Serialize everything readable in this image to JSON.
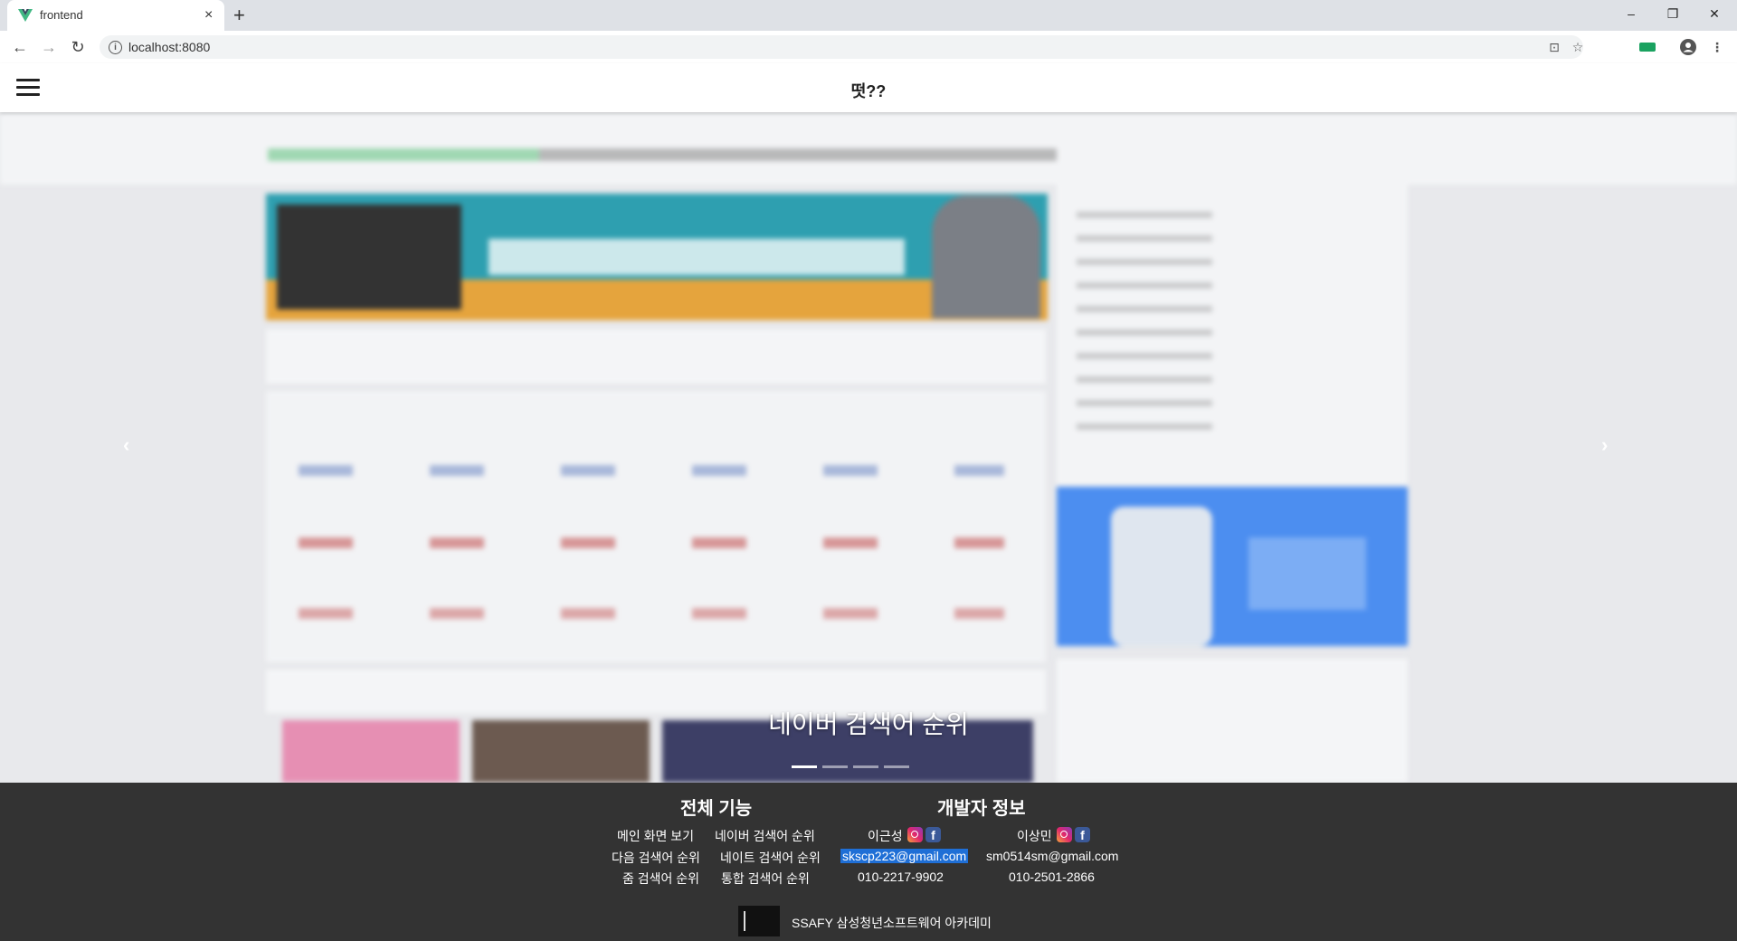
{
  "browser": {
    "tab_title": "frontend",
    "new_tab": "+",
    "tab_close": "×",
    "url": "localhost:8080",
    "win_minimize": "–",
    "win_restore": "❐",
    "win_close": "✕"
  },
  "header": {
    "title": "떳??"
  },
  "carousel": {
    "caption": "네이버 검색어 순위",
    "prev": "‹",
    "next": "›",
    "indicator_count": 4,
    "active_index": 0
  },
  "footer": {
    "features": {
      "heading": "전체 기능",
      "links": [
        "메인 화면 보기",
        "네이버 검색어 순위",
        "다음 검색어 순위",
        "네이트 검색어 순위",
        "줌 검색어 순위",
        "통합 검색어 순위"
      ]
    },
    "developers": {
      "heading": "개발자 정보",
      "people": [
        {
          "name": "이근성",
          "email": "skscp223@gmail.com",
          "phone": "010-2217-9902"
        },
        {
          "name": "이상민",
          "email": "sm0514sm@gmail.com",
          "phone": "010-2501-2866"
        }
      ]
    },
    "org": "SSAFY 삼성청년소프트웨어 아카데미"
  },
  "colors": {
    "footer_bg": "#333333",
    "email_highlight": "#1f6fd6",
    "instagram": "#e0266d",
    "facebook": "#3b5998"
  },
  "icons": [
    "vue-favicon-icon",
    "info-icon",
    "translate-icon",
    "star-icon",
    "extension-icon",
    "profile-icon",
    "menu-dots-icon",
    "hamburger-icon",
    "instagram-icon",
    "facebook-icon"
  ]
}
